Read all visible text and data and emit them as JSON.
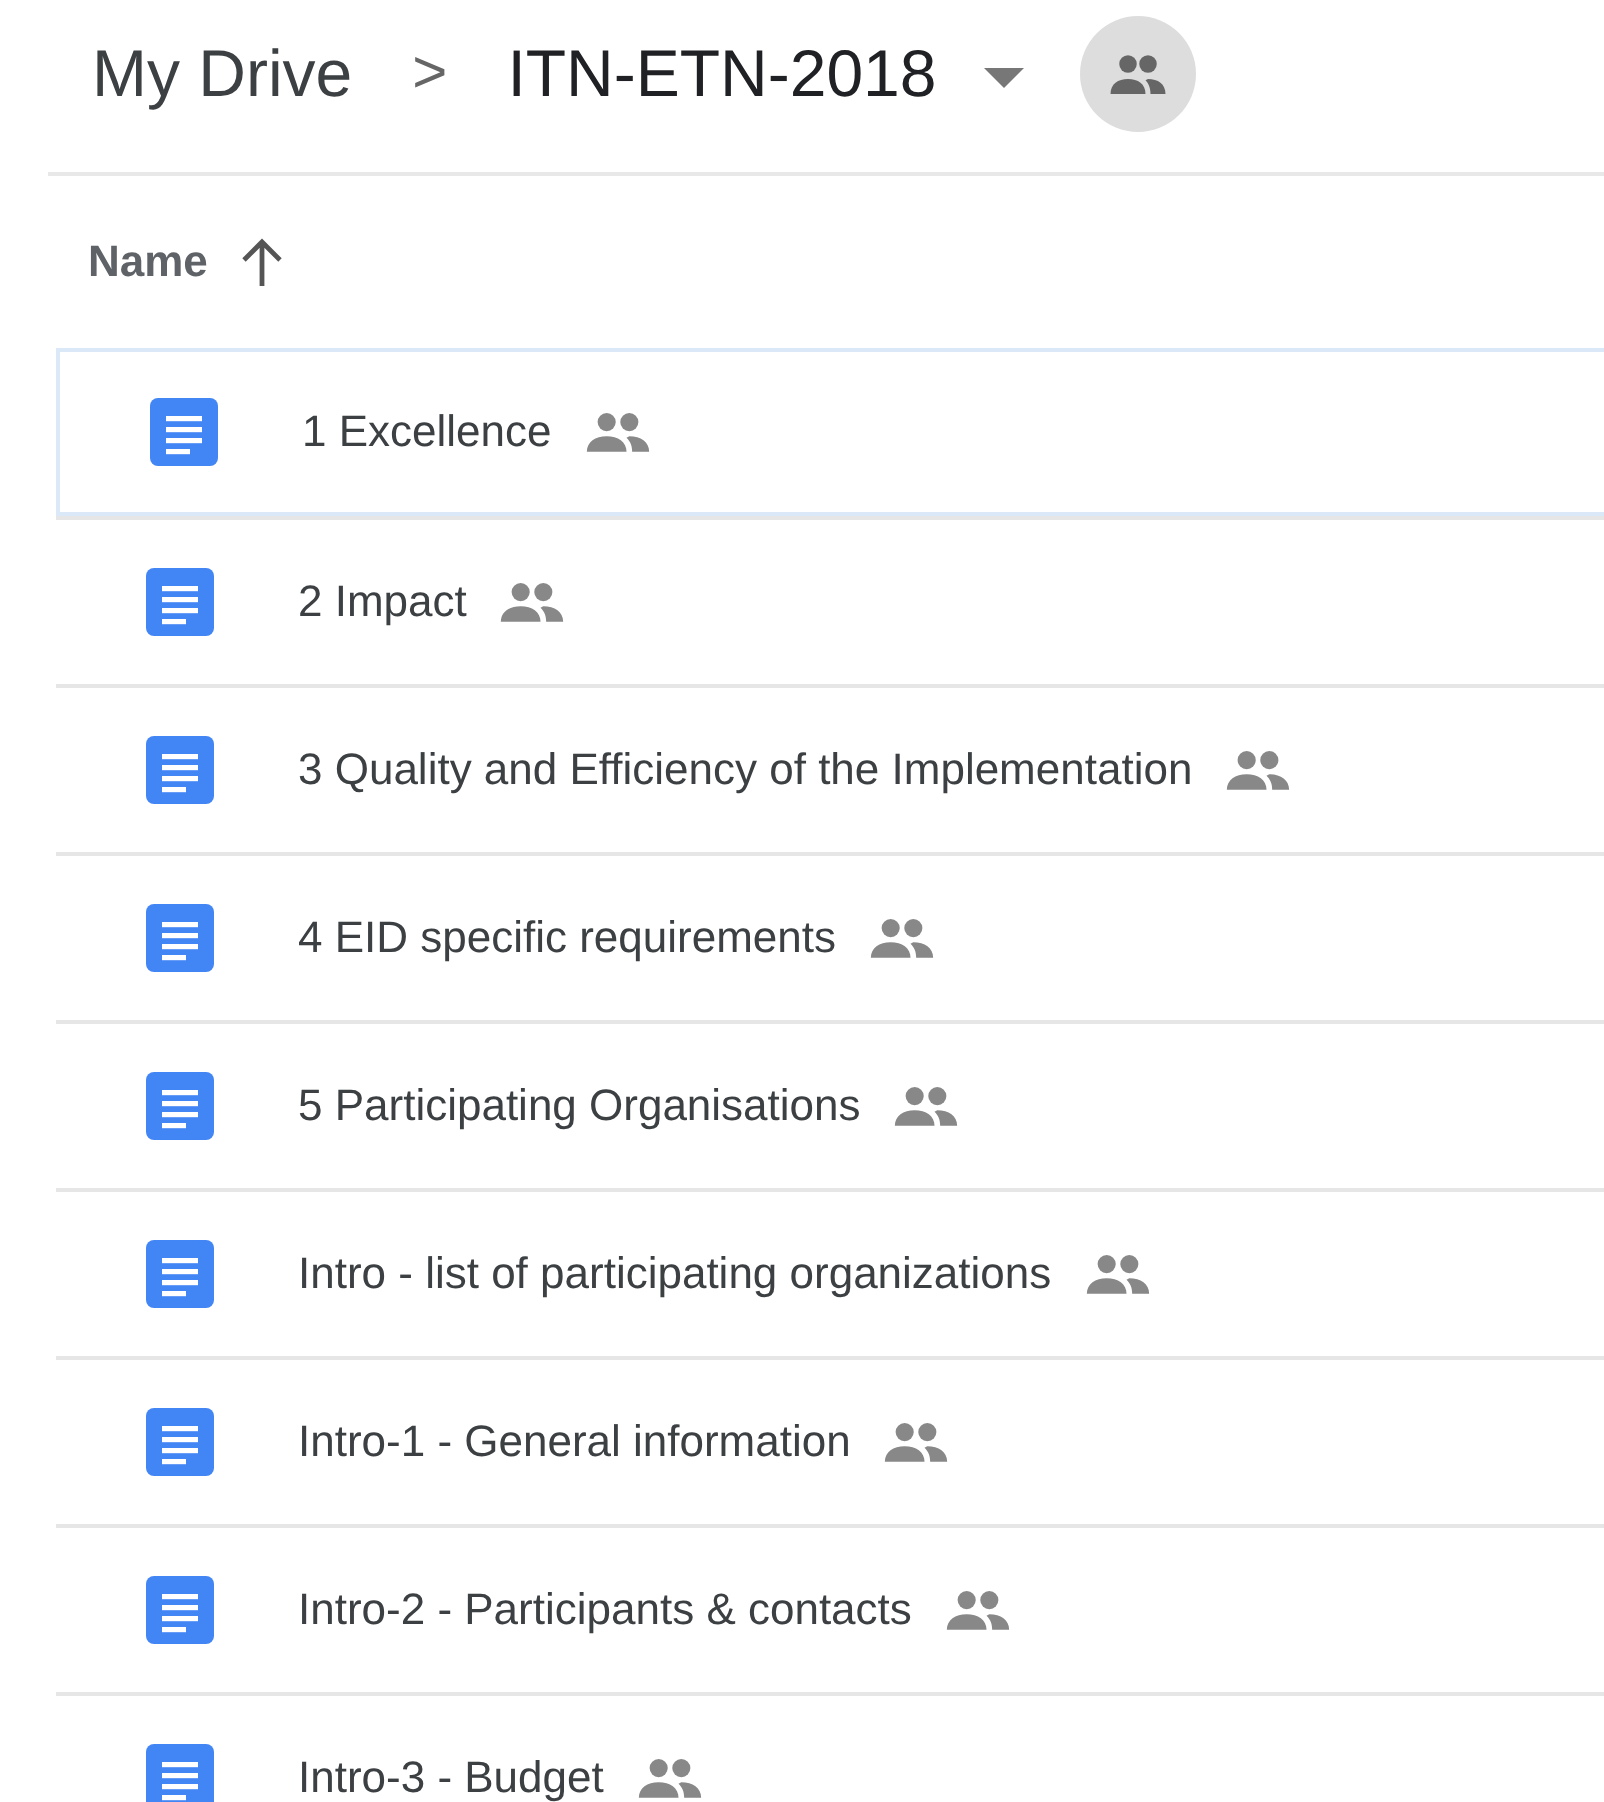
{
  "breadcrumb": {
    "root": "My Drive",
    "separator": ">",
    "current": "ITN-ETN-2018",
    "shared": true
  },
  "columns": [
    {
      "label": "Name",
      "ascending": true
    }
  ],
  "files": [
    {
      "name": "1 Excellence",
      "shared": true,
      "selected": true
    },
    {
      "name": "2 Impact",
      "shared": true,
      "selected": false
    },
    {
      "name": "3 Quality and Efficiency of the Implementation",
      "shared": true,
      "selected": false
    },
    {
      "name": "4 EID specific requirements",
      "shared": true,
      "selected": false
    },
    {
      "name": "5 Participating Organisations",
      "shared": true,
      "selected": false
    },
    {
      "name": "Intro - list of participating organizations",
      "shared": true,
      "selected": false
    },
    {
      "name": "Intro-1 - General information",
      "shared": true,
      "selected": false
    },
    {
      "name": "Intro-2 - Participants & contacts",
      "shared": true,
      "selected": false
    },
    {
      "name": "Intro-3 - Budget",
      "shared": true,
      "selected": false
    }
  ]
}
